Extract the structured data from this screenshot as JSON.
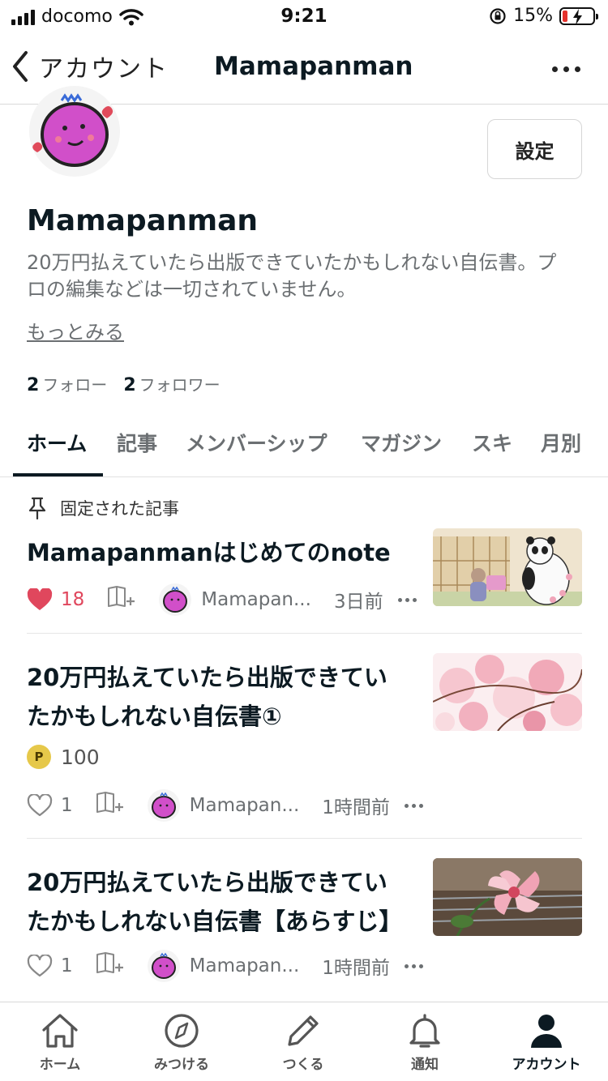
{
  "status_bar": {
    "carrier": "docomo",
    "time": "9:21",
    "battery": "15%"
  },
  "nav": {
    "back_label": "アカウント",
    "title": "Mamapanman"
  },
  "profile": {
    "settings_label": "設定",
    "name": "Mamapanman",
    "bio": "20万円払えていたら出版できていたかもしれない自伝書。プロの編集などは一切されていません。",
    "more_label": "もっとみる",
    "follow_count": "2",
    "follow_label": "フォロー",
    "follower_count": "2",
    "follower_label": "フォロワー"
  },
  "tabs": [
    "ホーム",
    "記事",
    "メンバーシップ",
    "マガジン",
    "スキ",
    "月別"
  ],
  "pinned_label": "固定された記事",
  "articles": [
    {
      "title": "Mamapanmanはじめてのnote",
      "likes": "18",
      "author": "Mamapan...",
      "time": "3日前"
    },
    {
      "title": "20万円払えていたら出版できていたかもしれない自伝書①",
      "price": "100",
      "price_icon": "P",
      "likes": "1",
      "author": "Mamapan...",
      "time": "1時間前"
    },
    {
      "title": "20万円払えていたら出版できていたかもしれない自伝書【あらすじ】",
      "likes": "1",
      "author": "Mamapan...",
      "time": "1時間前"
    }
  ],
  "tab_bar": [
    "ホーム",
    "みつける",
    "つくる",
    "通知",
    "アカウント"
  ],
  "colors": {
    "accent_like": "#e0475d",
    "text": "#0c1a22",
    "muted": "#6b6f72"
  }
}
